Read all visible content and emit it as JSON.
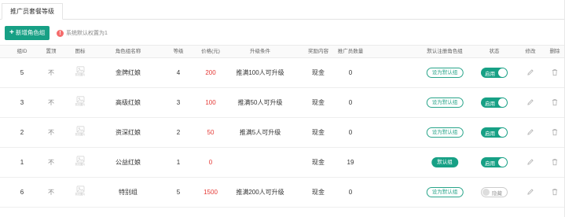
{
  "tab": {
    "label": "推广员套餐等级"
  },
  "toolbar": {
    "add_label": "新增角色组",
    "hint": "系统默认权置为1"
  },
  "table": {
    "headers": [
      "组ID",
      "置顶",
      "图标",
      "角色组名称",
      "等级",
      "价格(元)",
      "升级条件",
      "奖励内容",
      "推广员数量",
      "默认注册角色组",
      "状态",
      "修改",
      "删除"
    ],
    "icon_placeholder": "暂无图片",
    "rows": [
      {
        "id": "5",
        "top": "不",
        "name": "金牌红娘",
        "level": "4",
        "price": "200",
        "condition": "推满100人可升级",
        "reward": "现金",
        "count": "0",
        "default_label": "设为默认组",
        "is_default": false,
        "status": "启用",
        "enabled": true
      },
      {
        "id": "3",
        "top": "不",
        "name": "高级红娘",
        "level": "3",
        "price": "100",
        "condition": "推满50人可升级",
        "reward": "现金",
        "count": "0",
        "default_label": "设为默认组",
        "is_default": false,
        "status": "启用",
        "enabled": true
      },
      {
        "id": "2",
        "top": "不",
        "name": "资深红娘",
        "level": "2",
        "price": "50",
        "condition": "推满5人可升级",
        "reward": "现金",
        "count": "0",
        "default_label": "设为默认组",
        "is_default": false,
        "status": "启用",
        "enabled": true
      },
      {
        "id": "1",
        "top": "不",
        "name": "公益红娘",
        "level": "1",
        "price": "0",
        "condition": "",
        "reward": "现金",
        "count": "19",
        "default_label": "默认组",
        "is_default": true,
        "status": "启用",
        "enabled": true
      },
      {
        "id": "6",
        "top": "不",
        "name": "特别组",
        "level": "5",
        "price": "1500",
        "condition": "推满200人可升级",
        "reward": "现金",
        "count": "0",
        "default_label": "设为默认组",
        "is_default": false,
        "status": "隐藏",
        "enabled": false
      }
    ]
  },
  "colors": {
    "accent": "#17a085",
    "price": "#e53935",
    "warn": "#f56c6c"
  },
  "icons": {
    "add": "plus-icon",
    "hint": "warning-circle-icon",
    "edit": "pencil-icon",
    "delete": "trash-icon",
    "image": "image-placeholder-icon"
  }
}
